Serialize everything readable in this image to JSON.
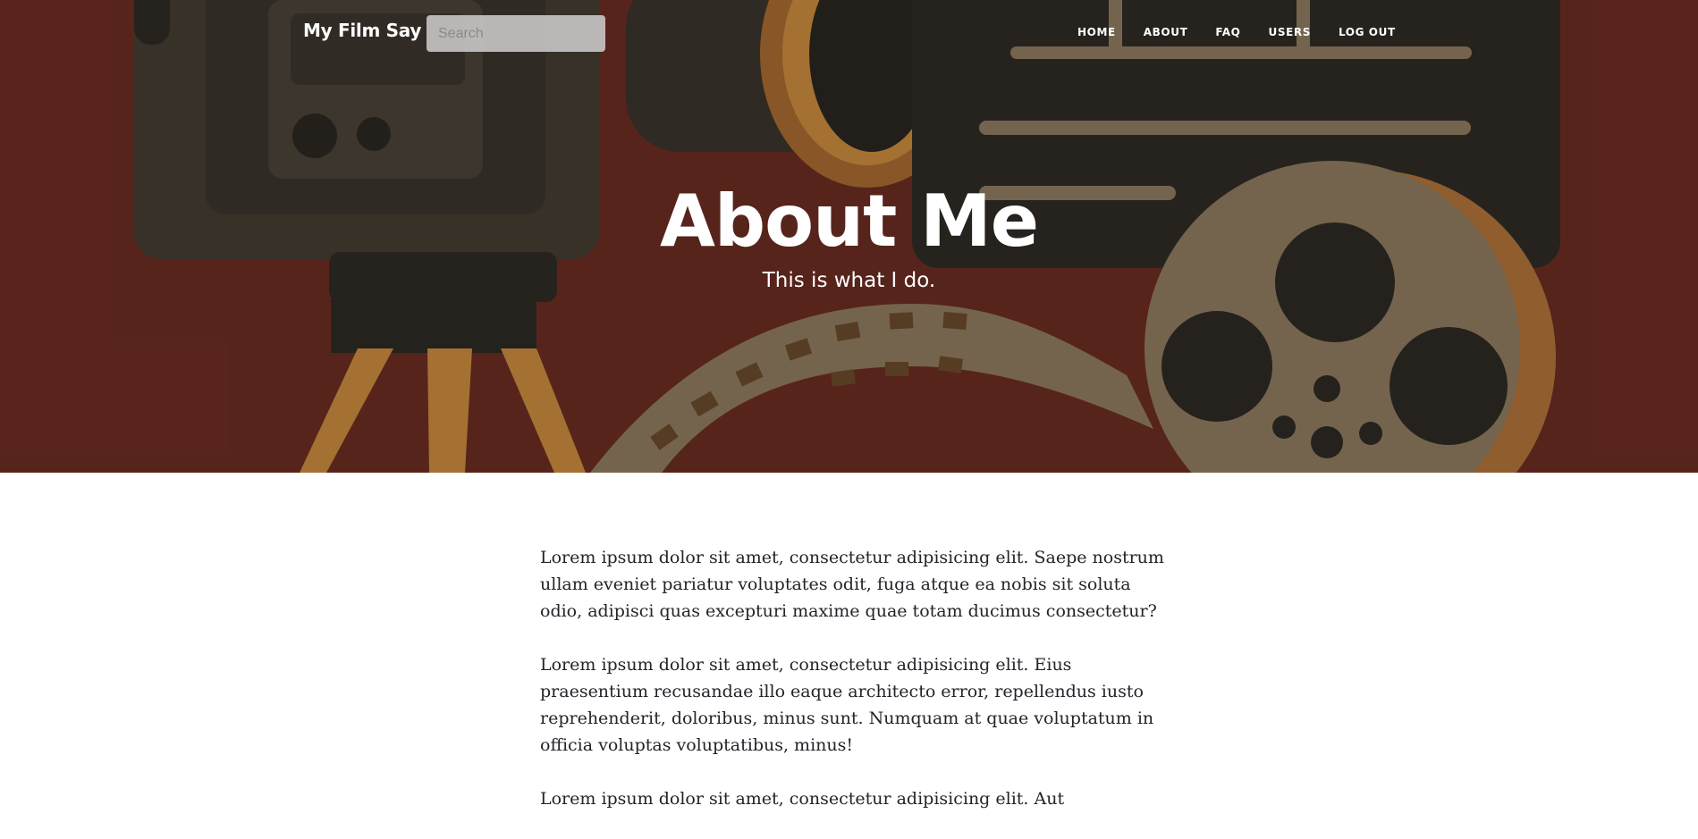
{
  "brand": {
    "name": "My Film Say"
  },
  "search": {
    "placeholder": "Search",
    "value": ""
  },
  "nav": {
    "items": [
      {
        "label": "HOME"
      },
      {
        "label": "ABOUT"
      },
      {
        "label": "FAQ"
      },
      {
        "label": "USERS"
      },
      {
        "label": "LOG OUT"
      }
    ]
  },
  "hero": {
    "title": "About Me",
    "subtitle": "This is what I do.",
    "background_image": "film-camera-and-reel-illustration",
    "colors": {
      "background": "#6a2d24",
      "camera": "#3e3a33",
      "accent": "#c98a3e",
      "reel": "#8f7b5f"
    }
  },
  "content": {
    "paragraphs": [
      "Lorem ipsum dolor sit amet, consectetur adipisicing elit. Saepe nostrum ullam eveniet pariatur voluptates odit, fuga atque ea nobis sit soluta odio, adipisci quas excepturi maxime quae totam ducimus consectetur?",
      "Lorem ipsum dolor sit amet, consectetur adipisicing elit. Eius praesentium recusandae illo eaque architecto error, repellendus iusto reprehenderit, doloribus, minus sunt. Numquam at quae voluptatum in officia voluptas voluptatibus, minus!",
      "Lorem ipsum dolor sit amet, consectetur adipisicing elit. Aut"
    ]
  }
}
